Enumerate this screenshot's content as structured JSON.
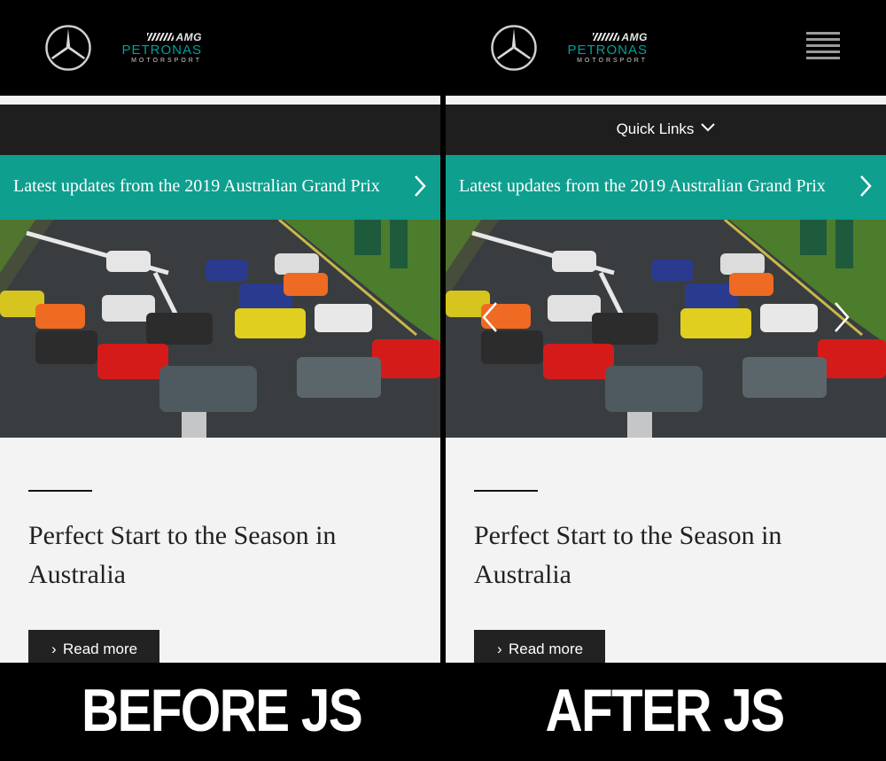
{
  "brand": {
    "amg": "AMG",
    "petronas": "PETRONAS",
    "motorsport": "MOTORSPORT"
  },
  "nav": {
    "quick_links": "Quick Links"
  },
  "banner": {
    "text": "Latest updates from the 2019 Australian Grand Prix"
  },
  "article": {
    "headline": "Perfect Start to the Season in Australia",
    "read_more": "Read more"
  },
  "captions": {
    "before": "BEFORE JS",
    "after": "AFTER JS"
  },
  "icons": [
    "mercedes-star-icon",
    "hamburger-menu-icon",
    "chevron-down-icon",
    "chevron-right-icon",
    "chevron-left-icon"
  ],
  "colors": {
    "teal": "#0e9f8f",
    "black": "#000000",
    "dark_bar": "#1e1e1e",
    "page_bg": "#f3f3f3",
    "button": "#222222"
  }
}
